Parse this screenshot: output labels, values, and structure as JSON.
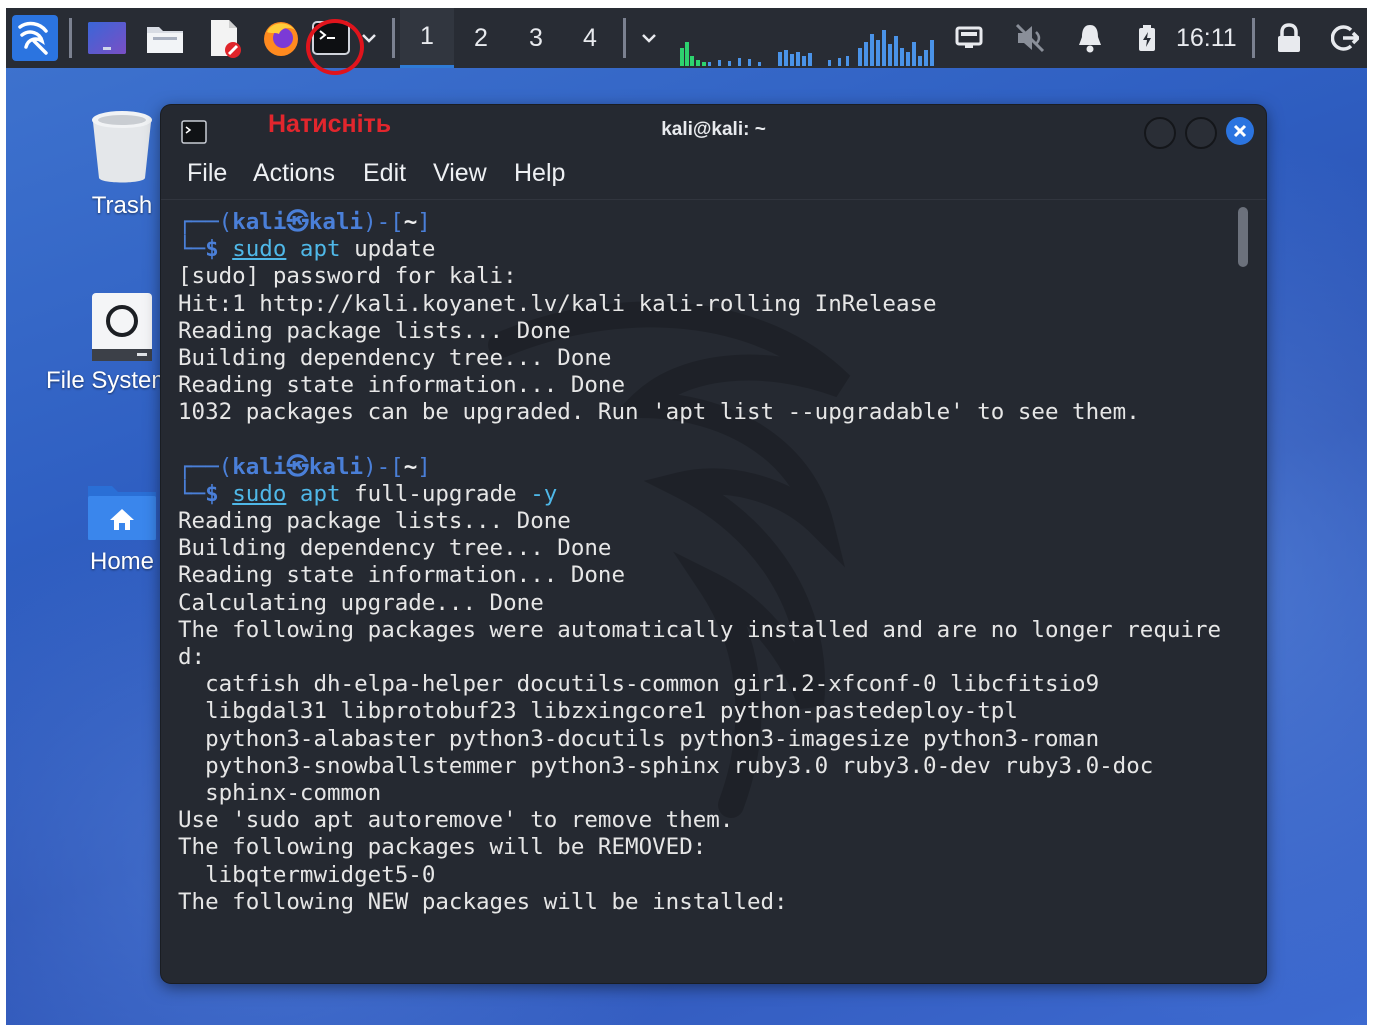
{
  "panel": {
    "workspaces": [
      "1",
      "2",
      "3",
      "4"
    ],
    "active_workspace": "1",
    "clock": "16:11",
    "icons": [
      "kali-menu-icon",
      "desktop-icon",
      "file-manager-icon",
      "text-editor-icon",
      "firefox-icon",
      "terminal-icon",
      "chevron-down-icon",
      "network-icon",
      "mute-icon",
      "notifications-icon",
      "battery-icon",
      "lock-icon",
      "logout-icon"
    ]
  },
  "desktop": {
    "icons": [
      {
        "label": "Trash"
      },
      {
        "label": "File System"
      },
      {
        "label": "Home"
      }
    ]
  },
  "annotation": {
    "text": "Натисніть",
    "color": "#e2262d"
  },
  "window": {
    "title": "kali@kali: ~",
    "menu": [
      "File",
      "Actions",
      "Edit",
      "View",
      "Help"
    ]
  },
  "terminal": {
    "prompt1": {
      "user": "kali",
      "host": "kali",
      "dir": "~",
      "cmd_sudo": "sudo",
      "cmd_apt": "apt",
      "cmd_rest": "update"
    },
    "output1": [
      "[sudo] password for kali:",
      "Hit:1 http://kali.koyanet.lv/kali kali-rolling InRelease",
      "Reading package lists... Done",
      "Building dependency tree... Done",
      "Reading state information... Done",
      "1032 packages can be upgraded. Run 'apt list --upgradable' to see them."
    ],
    "prompt2": {
      "user": "kali",
      "host": "kali",
      "dir": "~",
      "cmd_sudo": "sudo",
      "cmd_apt": "apt",
      "cmd_rest": "full-upgrade",
      "cmd_flag": "-y"
    },
    "output2": [
      "Reading package lists... Done",
      "Building dependency tree... Done",
      "Reading state information... Done",
      "Calculating upgrade... Done",
      "The following packages were automatically installed and are no longer require",
      "d:",
      "  catfish dh-elpa-helper docutils-common gir1.2-xfconf-0 libcfitsio9",
      "  libgdal31 libprotobuf23 libzxingcore1 python-pastedeploy-tpl",
      "  python3-alabaster python3-docutils python3-imagesize python3-roman",
      "  python3-snowballstemmer python3-sphinx ruby3.0 ruby3.0-dev ruby3.0-doc",
      "  sphinx-common",
      "Use 'sudo apt autoremove' to remove them.",
      "The following packages will be REMOVED:",
      "  libqtermwidget5-0",
      "The following NEW packages will be installed:"
    ]
  },
  "colors": {
    "panel_bg": "#282c34",
    "terminal_bg": "#252931",
    "prompt_blue": "#4a7fd8",
    "command_cyan": "#4fb8e8",
    "close_button": "#2b74e0"
  }
}
